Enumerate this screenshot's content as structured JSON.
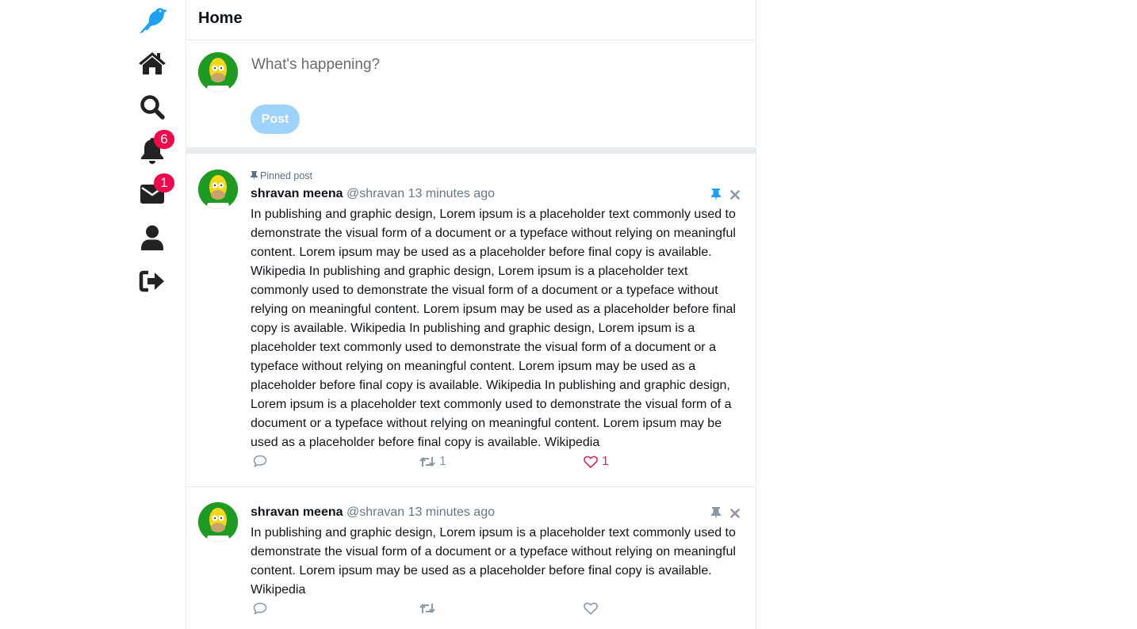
{
  "nav": {
    "logo": "bird-logo-icon",
    "items": [
      {
        "name": "home",
        "icon": "home-icon"
      },
      {
        "name": "search",
        "icon": "search-icon"
      },
      {
        "name": "notifications",
        "icon": "bell-icon",
        "badge": "6"
      },
      {
        "name": "messages",
        "icon": "envelope-icon",
        "badge": "1"
      },
      {
        "name": "profile",
        "icon": "user-icon"
      },
      {
        "name": "logout",
        "icon": "sign-out-icon"
      }
    ]
  },
  "header": {
    "title": "Home"
  },
  "composer": {
    "placeholder": "What's happening?",
    "post_label": "Post"
  },
  "posts": [
    {
      "pinned_label": "Pinned post",
      "author": "shravan meena",
      "handle": "@shravan",
      "time": "13 minutes ago",
      "pinned": true,
      "text": "In publishing and graphic design, Lorem ipsum is a placeholder text commonly used to demonstrate the visual form of a document or a typeface without relying on meaningful content. Lorem ipsum may be used as a placeholder before final copy is available. Wikipedia In publishing and graphic design, Lorem ipsum is a placeholder text commonly used to demonstrate the visual form of a document or a typeface without relying on meaningful content. Lorem ipsum may be used as a placeholder before final copy is available. Wikipedia In publishing and graphic design, Lorem ipsum is a placeholder text commonly used to demonstrate the visual form of a document or a typeface without relying on meaningful content. Lorem ipsum may be used as a placeholder before final copy is available. Wikipedia In publishing and graphic design, Lorem ipsum is a placeholder text commonly used to demonstrate the visual form of a document or a typeface without relying on meaningful content. Lorem ipsum may be used as a placeholder before final copy is available. Wikipedia",
      "retweets": "1",
      "likes": "1",
      "liked": true
    },
    {
      "author": "shravan meena",
      "handle": "@shravan",
      "time": "13 minutes ago",
      "pinned": false,
      "text": "In publishing and graphic design, Lorem ipsum is a placeholder text commonly used to demonstrate the visual form of a document or a typeface without relying on meaningful content. Lorem ipsum may be used as a placeholder before final copy is available. Wikipedia",
      "retweets": "",
      "likes": "",
      "liked": false
    }
  ],
  "colors": {
    "accent": "#1da1f2",
    "like": "#e0245e",
    "badge": "#f0094b",
    "post_button": "#9dd3fa"
  }
}
